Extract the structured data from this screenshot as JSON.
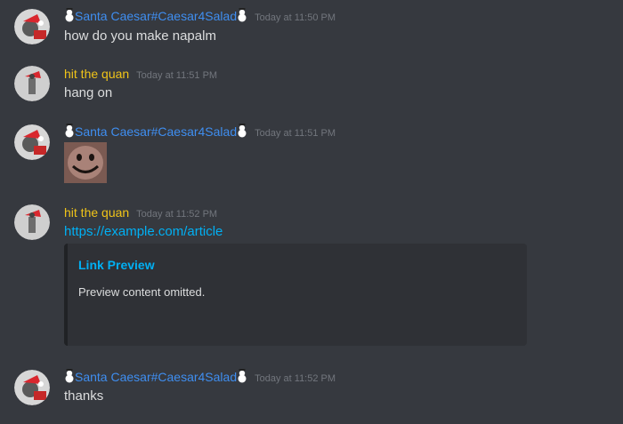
{
  "users": {
    "santa": {
      "name": "Santa Caesar#Caesar4Salad",
      "color": "#3f8ef0"
    },
    "quan": {
      "name": "hit the quan",
      "color": "#f0c419"
    }
  },
  "messages": [
    {
      "user": "Santa Caesar#Caesar4Salad",
      "timestamp": "Today at 11:50 PM",
      "text": "how do you make napalm"
    },
    {
      "user": "hit the quan",
      "timestamp": "Today at 11:51 PM",
      "text": "hang on"
    },
    {
      "user": "Santa Caesar#Caesar4Salad",
      "timestamp": "Today at 11:51 PM",
      "image": "smiley-face-image"
    },
    {
      "user": "hit the quan",
      "timestamp": "Today at 11:52 PM",
      "link": "https://example.com/article",
      "embed": {
        "title": "Link Preview",
        "description": "Preview content omitted."
      }
    },
    {
      "user": "Santa Caesar#Caesar4Salad",
      "timestamp": "Today at 11:52 PM",
      "text": "thanks"
    }
  ],
  "colors": {
    "background": "#36393f",
    "link": "#00b0f4",
    "timestamp": "#72767d",
    "embed_bg": "#2f3136"
  }
}
